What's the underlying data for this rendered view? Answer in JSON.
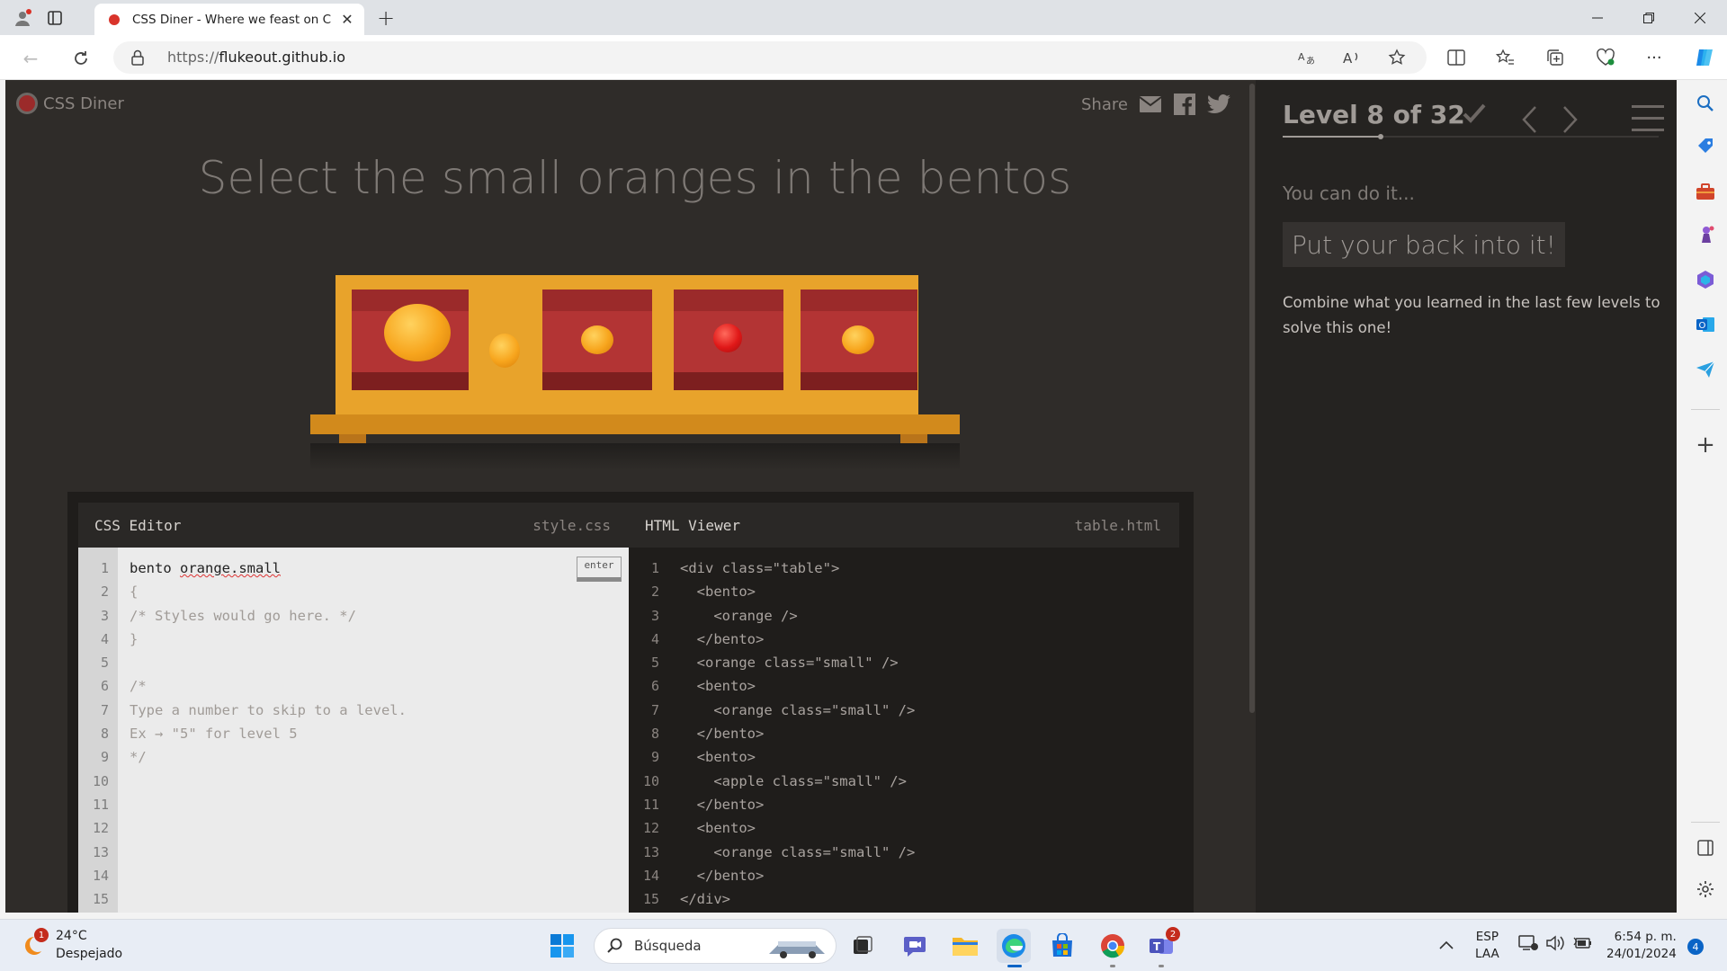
{
  "browser": {
    "tab_title": "CSS Diner - Where we feast on C",
    "new_tab_symbol": "+",
    "url_prefix": "https://",
    "url_host": "flukeout.github.io"
  },
  "site": {
    "logo_text": "CSS Diner",
    "share_label": "Share"
  },
  "instruction": "Select the small oranges in the bentos",
  "css_editor": {
    "title": "CSS Editor",
    "file": "style.css",
    "enter_label": "enter",
    "input_prefix": "bento ",
    "input_value": "orange.small",
    "line_numbers": [
      "1",
      "2",
      "3",
      "4",
      "5",
      "6",
      "7",
      "8",
      "9",
      "10",
      "11",
      "12",
      "13",
      "14",
      "15"
    ],
    "lines": [
      "{",
      "/* Styles would go here. */",
      "}",
      "",
      "/*",
      "Type a number to skip to a level.",
      "Ex → \"5\" for level 5",
      "*/"
    ]
  },
  "html_viewer": {
    "title": "HTML Viewer",
    "file": "table.html",
    "line_numbers": [
      "1",
      "2",
      "3",
      "4",
      "5",
      "6",
      "7",
      "8",
      "9",
      "10",
      "11",
      "12",
      "13",
      "14",
      "15"
    ],
    "lines": [
      "<div class=\"table\">",
      "  <bento>",
      "    <orange />",
      "  </bento>",
      "  <orange class=\"small\" />",
      "  <bento>",
      "    <orange class=\"small\" />",
      "  </bento>",
      "  <bento>",
      "    <apple class=\"small\" />",
      "  </bento>",
      "  <bento>",
      "    <orange class=\"small\" />",
      "  </bento>",
      "</div>"
    ]
  },
  "level": {
    "title": "Level 8 of 32",
    "progress_fraction": 0.25,
    "encouragement": "You can do it...",
    "hint": "Put your back into it!",
    "description": "Combine what you learned in the last few levels to solve this one!"
  },
  "taskbar": {
    "temperature": "24°C",
    "weather": "Despejado",
    "weather_badge": "1",
    "search_placeholder": "Búsqueda",
    "teams_badge": "2",
    "lang_top": "ESP",
    "lang_bottom": "LAA",
    "time": "6:54 p. m.",
    "date": "24/01/2024",
    "notif_count": "4"
  },
  "colors": {
    "page_bg": "#2f2c29",
    "table_wood": "#e8a32b",
    "bento_red": "#9b2a2a",
    "orange": "#f7a51d",
    "apple": "#e01818"
  }
}
